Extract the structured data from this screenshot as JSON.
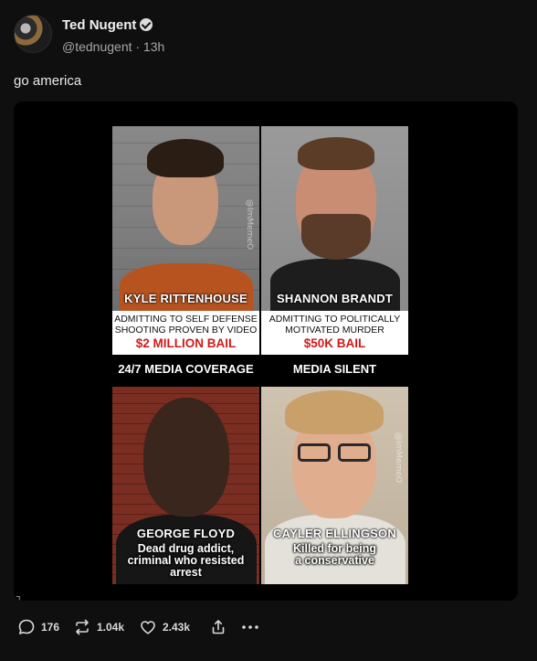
{
  "post": {
    "author_name": "Ted Nugent",
    "handle_time": "@tednugent · 13h",
    "text": "go america"
  },
  "meme": {
    "panels": [
      {
        "name": "KYLE RITTENHOUSE",
        "caption1": "ADMITTING TO SELF DEFENSE",
        "caption2": "SHOOTING PROVEN BY VIDEO",
        "bail": "$2 MILLION BAIL"
      },
      {
        "name": "SHANNON BRANDT",
        "caption1": "ADMITTING TO POLITICALLY",
        "caption2": "MOTIVATED MURDER",
        "bail": "$50K BAIL"
      },
      {
        "name": "GEORGE FLOYD",
        "caption1": "Dead drug addict,",
        "caption2": "criminal who resisted",
        "caption3": "arrest"
      },
      {
        "name": "CAYLER ELLINGSON",
        "caption1": "Killed for being",
        "caption2": "a conservative"
      }
    ],
    "coverage_left": "24/7 MEDIA COVERAGE",
    "coverage_right": "MEDIA SILENT",
    "watermark": "@ImMemeO"
  },
  "media": {
    "alt_badge": "┐"
  },
  "actions": {
    "reply_count": "176",
    "repost_count": "1.04k",
    "like_count": "2.43k"
  },
  "icons": {
    "reply": "reply-bubble-icon",
    "repost": "repost-icon",
    "like": "heart-icon",
    "share": "share-icon",
    "more": "more-dots-icon",
    "verified": "verified-badge-icon"
  },
  "colors": {
    "background": "#0f0f10",
    "bail_red": "#d31919"
  }
}
